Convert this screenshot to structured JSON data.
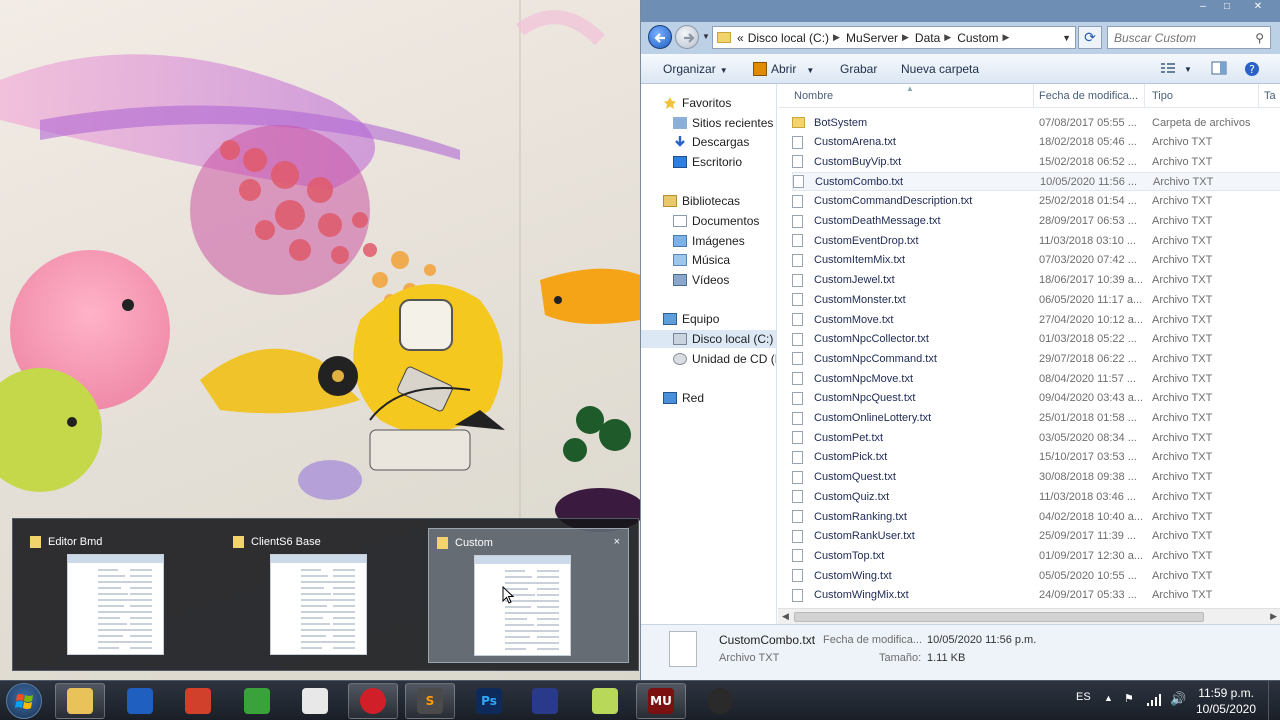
{
  "explorer": {
    "window_buttons": {
      "minimize": "–",
      "maximize": "□",
      "close": "✕"
    },
    "address": {
      "overflow": "«",
      "crumbs": [
        "Disco local (C:)",
        "MuServer",
        "Data",
        "Custom"
      ]
    },
    "search_placeholder": "Buscar Custom",
    "commands": {
      "organize": "Organizar",
      "open": "Abrir",
      "burn": "Grabar",
      "new_folder": "Nueva carpeta"
    },
    "nav": {
      "favorites": "Favoritos",
      "recent": "Sitios recientes",
      "downloads": "Descargas",
      "desktop": "Escritorio",
      "libraries": "Bibliotecas",
      "documents": "Documentos",
      "images": "Imágenes",
      "music": "Música",
      "videos": "Vídeos",
      "computer": "Equipo",
      "local_disk": "Disco local (C:)",
      "cd_drive": "Unidad de CD (D",
      "network": "Red"
    },
    "columns": {
      "name": "Nombre",
      "modified": "Fecha de modifica...",
      "type": "Tipo",
      "size": "Ta"
    },
    "files": [
      {
        "name": "BotSystem",
        "date": "07/08/2017 05:55 ...",
        "type": "Carpeta de archivos"
      },
      {
        "name": "CustomArena.txt",
        "date": "18/02/2018 05:46 ...",
        "type": "Archivo TXT"
      },
      {
        "name": "CustomBuyVip.txt",
        "date": "15/02/2018 06:52 ...",
        "type": "Archivo TXT"
      },
      {
        "name": "CustomCombo.txt",
        "date": "10/05/2020 11:56 ...",
        "type": "Archivo TXT"
      },
      {
        "name": "CustomCommandDescription.txt",
        "date": "25/02/2018 01:54 ...",
        "type": "Archivo TXT"
      },
      {
        "name": "CustomDeathMessage.txt",
        "date": "28/09/2017 06:53 ...",
        "type": "Archivo TXT"
      },
      {
        "name": "CustomEventDrop.txt",
        "date": "11/03/2018 03:10 ...",
        "type": "Archivo TXT"
      },
      {
        "name": "CustomItemMix.txt",
        "date": "07/03/2020 07:42 ...",
        "type": "Archivo TXT"
      },
      {
        "name": "CustomJewel.txt",
        "date": "18/06/2017 10:39 a...",
        "type": "Archivo TXT"
      },
      {
        "name": "CustomMonster.txt",
        "date": "06/05/2020 11:17 a...",
        "type": "Archivo TXT"
      },
      {
        "name": "CustomMove.txt",
        "date": "27/04/2020 10:12 a...",
        "type": "Archivo TXT"
      },
      {
        "name": "CustomNpcCollector.txt",
        "date": "01/03/2018 05:22 ...",
        "type": "Archivo TXT"
      },
      {
        "name": "CustomNpcCommand.txt",
        "date": "29/07/2018 06:22 ...",
        "type": "Archivo TXT"
      },
      {
        "name": "CustomNpcMove.txt",
        "date": "08/04/2020 11:57 ...",
        "type": "Archivo TXT"
      },
      {
        "name": "CustomNpcQuest.txt",
        "date": "09/04/2020 03:43 a...",
        "type": "Archivo TXT"
      },
      {
        "name": "CustomOnlineLottery.txt",
        "date": "25/01/2018 01:58 ...",
        "type": "Archivo TXT"
      },
      {
        "name": "CustomPet.txt",
        "date": "03/05/2020 08:34 ...",
        "type": "Archivo TXT"
      },
      {
        "name": "CustomPick.txt",
        "date": "15/10/2017 03:53 ...",
        "type": "Archivo TXT"
      },
      {
        "name": "CustomQuest.txt",
        "date": "30/08/2018 09:38 ...",
        "type": "Archivo TXT"
      },
      {
        "name": "CustomQuiz.txt",
        "date": "11/03/2018 03:46 ...",
        "type": "Archivo TXT"
      },
      {
        "name": "CustomRanking.txt",
        "date": "04/02/2018 10:40 a...",
        "type": "Archivo TXT"
      },
      {
        "name": "CustomRankUser.txt",
        "date": "25/09/2017 11:39 ...",
        "type": "Archivo TXT"
      },
      {
        "name": "CustomTop.txt",
        "date": "01/09/2017 12:30 a...",
        "type": "Archivo TXT"
      },
      {
        "name": "CustomWing.txt",
        "date": "05/05/2020 10:55 ...",
        "type": "Archivo TXT"
      },
      {
        "name": "CustomWingMix.txt",
        "date": "24/09/2017 05:33 ...",
        "type": "Archivo TXT"
      }
    ],
    "details": {
      "name": "CustomCombo.txt",
      "modified_label": "Fecha de modifica...",
      "modified_value": "10/05/2020 11:56 p.m.",
      "type": "Archivo TXT",
      "size_label": "Tamaño:",
      "size_value": "1.11 KB"
    }
  },
  "thumbnails": [
    {
      "title": "Editor Bmd"
    },
    {
      "title": "ClientS6 Base"
    },
    {
      "title": "Custom",
      "close": "×"
    }
  ],
  "taskbar": {
    "language": "ES",
    "time": "11:59 p.m.",
    "date": "10/05/2020",
    "apps": [
      "explorer-icon",
      "chrome-like-icon",
      "tools-icon",
      "refresh-app-icon",
      "box-icon",
      "opera-icon",
      "sublime-icon",
      "photoshop-icon",
      "infinity-icon",
      "folder-green-icon",
      "game-icon",
      "obs-icon"
    ],
    "app_labels": {
      "photoshop": "Ps",
      "sublime": "S",
      "game": "MU"
    }
  },
  "colors": {
    "titlebar": "#6e8eb4",
    "selected_row": "#f3f6fa",
    "taskbar": "#1a1f27"
  }
}
